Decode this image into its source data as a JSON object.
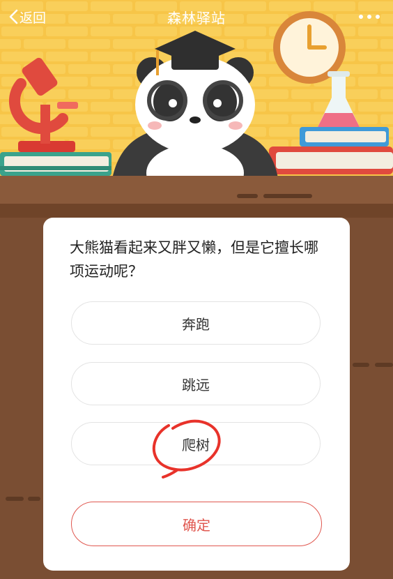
{
  "header": {
    "back_label": "返回",
    "title": "森林驿站",
    "more_icon": "more-dots-icon"
  },
  "quiz": {
    "question": "大熊猫看起来又胖又懒，但是它擅长哪项运动呢？",
    "options": [
      "奔跑",
      "跳远",
      "爬树"
    ],
    "confirm_label": "确定",
    "marked_option": "爬树"
  },
  "colors": {
    "background_yellow": "#f7c548",
    "desk_brown": "#7a4e33",
    "accent_red": "#e0574f",
    "annotation_red": "#e8322a"
  }
}
